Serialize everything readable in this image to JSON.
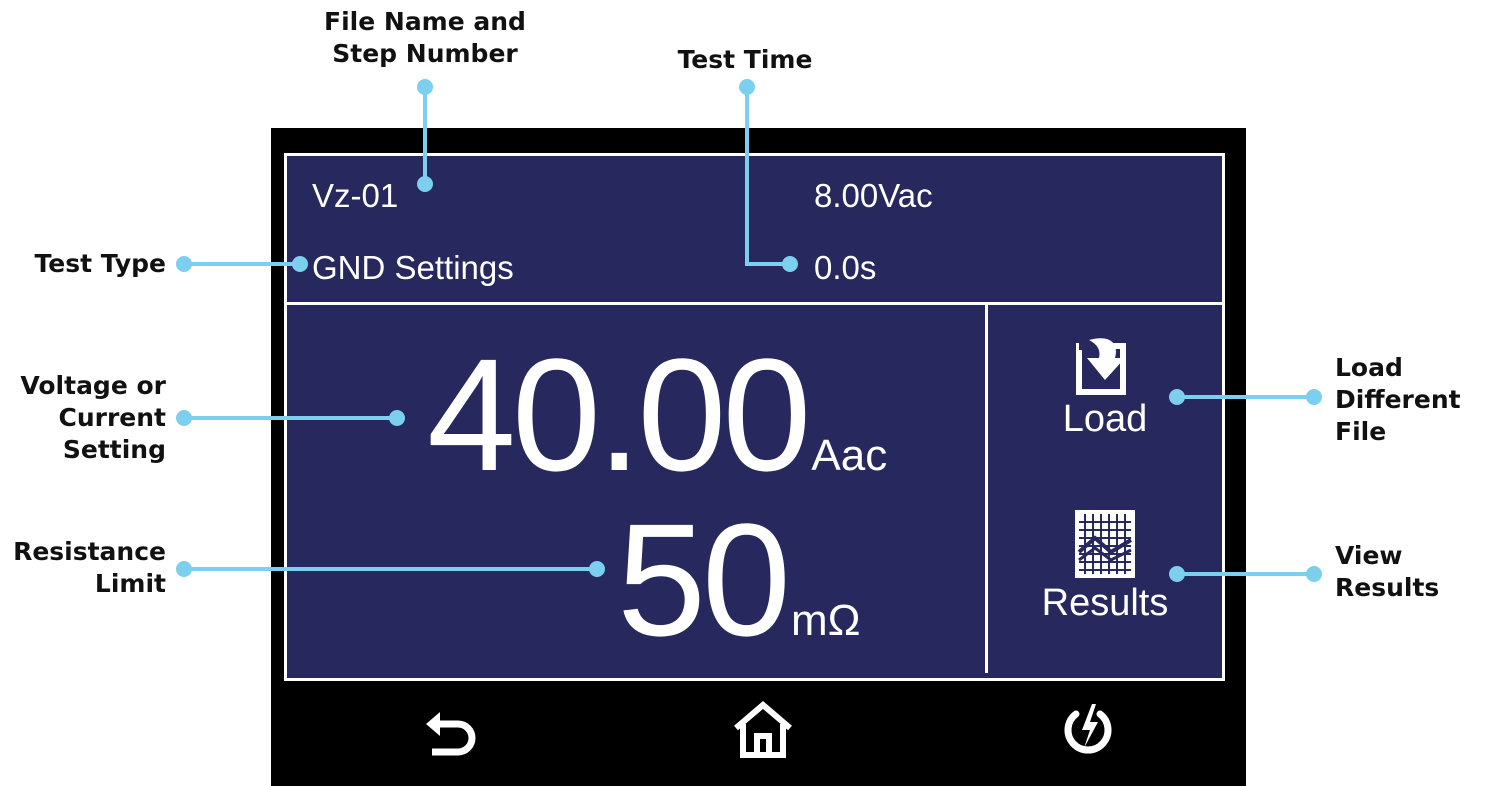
{
  "callouts": {
    "file_name_step": [
      "File Name and",
      "Step Number"
    ],
    "test_time": "Test Time",
    "test_type": "Test Type",
    "voltage_current": [
      "Voltage or",
      "Current",
      "Setting"
    ],
    "resistance_limit": [
      "Resistance",
      "Limit"
    ],
    "load_file": [
      "Load",
      "Different",
      "File"
    ],
    "view_results": [
      "View",
      "Results"
    ]
  },
  "colors": {
    "screen_bg": "#26285e",
    "bezel": "#000000",
    "callout_line": "#7ccfee"
  },
  "screen": {
    "file_step": "Vz-01",
    "voltage_setting": "8.00Vac",
    "test_type": "GND Settings",
    "test_time": "0.0s",
    "current_value": "40.00",
    "current_unit": "Aac",
    "resistance_value": "50",
    "resistance_unit": "mΩ",
    "load_label": "Load",
    "results_label": "Results"
  },
  "nav": {
    "back_icon": "back-arrow-icon",
    "home_icon": "home-icon",
    "power_icon": "power-icon"
  }
}
